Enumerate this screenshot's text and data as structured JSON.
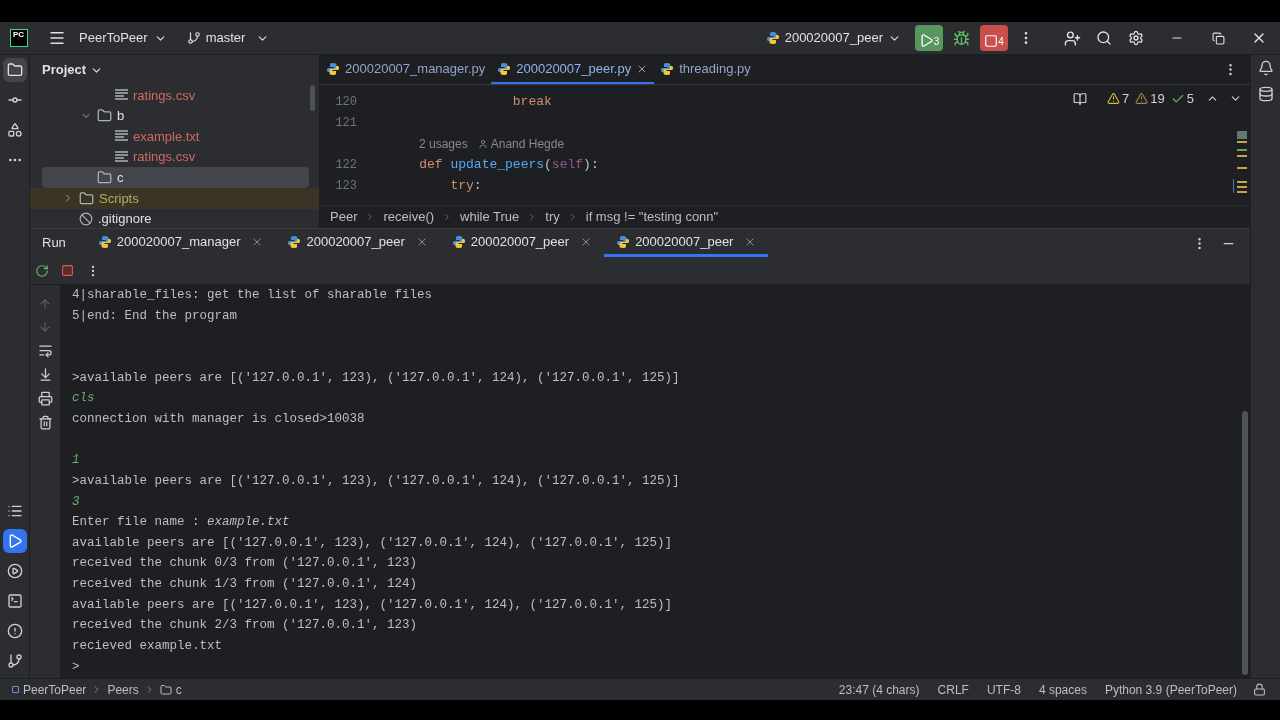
{
  "toolbar": {
    "logo": "PC",
    "project": "PeerToPeer",
    "branch": "master",
    "run_config": "200020007_peer",
    "run_count": "3",
    "stop_count": "4"
  },
  "left_tools": {
    "top": [
      {
        "kind": "project",
        "selected": true
      },
      {
        "kind": "commit",
        "selected": false
      },
      {
        "kind": "structure",
        "selected": false
      },
      {
        "kind": "more",
        "selected": false
      }
    ],
    "bottom": [
      {
        "kind": "todo",
        "selected": false
      },
      {
        "kind": "run",
        "selected": true
      },
      {
        "kind": "services",
        "selected": false
      },
      {
        "kind": "terminal",
        "selected": false
      },
      {
        "kind": "problems",
        "selected": false
      },
      {
        "kind": "git",
        "selected": false
      }
    ]
  },
  "project_panel": {
    "title": "Project",
    "tree": [
      {
        "children": [
          {
            "children": [
              {
                "name": "ratings.csv",
                "kind": "file",
                "color": "#cf6a63",
                "selected": false,
                "highlighted": false
              }
            ]
          },
          {
            "name": "b",
            "kind": "folder",
            "color": "#dfe1e5",
            "expanded": true,
            "selected": false,
            "highlighted": false,
            "children": [
              {
                "name": "example.txt",
                "kind": "file",
                "color": "#cf6a63",
                "selected": false,
                "highlighted": false
              },
              {
                "name": "ratings.csv",
                "kind": "file",
                "color": "#cf6a63",
                "selected": false,
                "highlighted": false
              }
            ]
          },
          {
            "name": "c",
            "kind": "folder",
            "color": "#dfe1e5",
            "selected": true,
            "highlighted": false
          }
        ]
      },
      {
        "name": "Scripts",
        "kind": "folder",
        "color": "#b3ae60",
        "expanded": false,
        "selected": false,
        "highlighted": true
      },
      {
        "name": ".gitignore",
        "kind": "ignore",
        "color": "#dfe1e5",
        "selected": false,
        "highlighted": false
      }
    ]
  },
  "editor": {
    "tabs": [
      {
        "label": "200020007_manager.py",
        "selected": false
      },
      {
        "label": "200020007_peer.py",
        "selected": true
      },
      {
        "label": "threading.py",
        "selected": false
      }
    ],
    "inspections": {
      "warnings": "7",
      "weak_warnings": "19",
      "typos": "5"
    },
    "lines": [
      {
        "kind": "code",
        "number": "120",
        "tokens": [
          {
            "kind": "keyword",
            "text": "                break"
          }
        ]
      },
      {
        "kind": "code",
        "number": "121"
      },
      {
        "kind": "hint",
        "usages": "2 usages",
        "author": "Anand Hegde"
      },
      {
        "kind": "code",
        "number": "122",
        "tokens": [
          {
            "kind": "keyword",
            "text": "    def "
          },
          {
            "kind": "function",
            "text": "update_peers"
          },
          {
            "kind": "plain",
            "text": "("
          },
          {
            "kind": "self",
            "text": "self"
          },
          {
            "kind": "plain",
            "text": "):"
          }
        ]
      },
      {
        "kind": "code",
        "number": "123",
        "tokens": [
          {
            "kind": "keyword",
            "text": "        try"
          },
          {
            "kind": "plain",
            "text": ":"
          }
        ]
      }
    ],
    "breadcrumbs": [
      "Peer",
      "receive()",
      "while True",
      "try",
      "if msg != \"testing conn\""
    ]
  },
  "run_panel": {
    "title": "Run",
    "tabs": [
      {
        "label": "200020007_manager",
        "selected": false
      },
      {
        "label": "200020007_peer",
        "selected": false
      },
      {
        "label": "200020007_peer",
        "selected": false
      },
      {
        "label": "200020007_peer",
        "selected": true
      }
    ],
    "console": [
      {
        "kind": "output",
        "text": "4|sharable_files: get the list of sharable files"
      },
      {
        "kind": "output",
        "text": "5|end: End the program"
      },
      {
        "kind": "blank"
      },
      {
        "kind": "blank"
      },
      {
        "kind": "output",
        "text": ">available peers are [('127.0.0.1', 123), ('127.0.0.1', 124), ('127.0.0.1', 125)]"
      },
      {
        "kind": "input",
        "text": "cls"
      },
      {
        "kind": "output",
        "text": "connection with manager is closed>10038"
      },
      {
        "kind": "blank"
      },
      {
        "kind": "input",
        "text": "1"
      },
      {
        "kind": "output",
        "text": ">available peers are [('127.0.0.1', 123), ('127.0.0.1', 124), ('127.0.0.1', 125)]"
      },
      {
        "kind": "input",
        "text": "3"
      },
      {
        "kind": "output",
        "text": "Enter file name : *example.txt*"
      },
      {
        "kind": "output",
        "text": "available peers are [('127.0.0.1', 123), ('127.0.0.1', 124), ('127.0.0.1', 125)]"
      },
      {
        "kind": "output",
        "text": "received the chunk 0/3 from ('127.0.0.1', 123)"
      },
      {
        "kind": "output",
        "text": "received the chunk 1/3 from ('127.0.0.1', 124)"
      },
      {
        "kind": "output",
        "text": "available peers are [('127.0.0.1', 123), ('127.0.0.1', 124), ('127.0.0.1', 125)]"
      },
      {
        "kind": "output",
        "text": "received the chunk 2/3 from ('127.0.0.1', 123)"
      },
      {
        "kind": "output",
        "text": "recieved example.txt"
      },
      {
        "kind": "output",
        "text": ">"
      }
    ]
  },
  "status_bar": {
    "path": [
      "PeerToPeer",
      "Peers",
      "c"
    ],
    "caret_position": "23:47 (4 chars)",
    "line_separator": "CRLF",
    "encoding": "UTF-8",
    "indent": "4 spaces",
    "interpreter": "Python 3.9 (PeerToPeer)"
  }
}
